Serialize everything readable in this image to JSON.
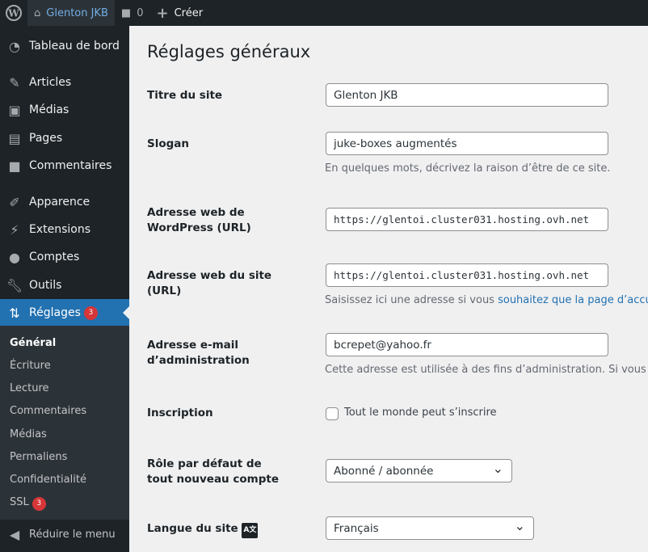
{
  "adminbar": {
    "site_name": "Glenton JKB",
    "comments_count": "0",
    "new_label": "Créer"
  },
  "sidebar": {
    "items": [
      {
        "label": "Tableau de bord",
        "icon": "dashboard-icon"
      },
      {
        "label": "Articles",
        "icon": "pin-icon"
      },
      {
        "label": "Médias",
        "icon": "media-icon"
      },
      {
        "label": "Pages",
        "icon": "pages-icon"
      },
      {
        "label": "Commentaires",
        "icon": "comments-icon"
      },
      {
        "label": "Apparence",
        "icon": "brush-icon"
      },
      {
        "label": "Extensions",
        "icon": "plugin-icon"
      },
      {
        "label": "Comptes",
        "icon": "user-icon"
      },
      {
        "label": "Outils",
        "icon": "wrench-icon"
      },
      {
        "label": "Réglages",
        "icon": "settings-icon",
        "badge": "3"
      }
    ],
    "submenu": [
      {
        "label": "Général"
      },
      {
        "label": "Écriture"
      },
      {
        "label": "Lecture"
      },
      {
        "label": "Commentaires"
      },
      {
        "label": "Médias"
      },
      {
        "label": "Permaliens"
      },
      {
        "label": "Confidentialité"
      },
      {
        "label": "SSL",
        "badge": "3"
      }
    ],
    "collapse_label": "Réduire le menu"
  },
  "page": {
    "title": "Réglages généraux",
    "site_title": {
      "label": "Titre du site",
      "value": "Glenton JKB"
    },
    "tagline": {
      "label": "Slogan",
      "value": "juke-boxes augmentés",
      "desc": "En quelques mots, décrivez la raison d’être de ce site."
    },
    "wp_url": {
      "label": "Adresse web de WordPress (URL)",
      "value": "https://glentoi.cluster031.hosting.ovh.net"
    },
    "site_url": {
      "label": "Adresse web du site (URL)",
      "value": "https://glentoi.cluster031.hosting.ovh.net",
      "desc": "Saisissez ici une adresse si vous ",
      "desc_link": "souhaitez que la page d’accueil d"
    },
    "email": {
      "label": "Adresse e-mail d’administration",
      "value": "bcrepet@yahoo.fr",
      "desc": "Cette adresse est utilisée à des fins d’administration. Si vous la ch"
    },
    "membership": {
      "label": "Inscription",
      "checkbox_label": "Tout le monde peut s’inscrire",
      "checked": false
    },
    "role": {
      "label": "Rôle par défaut de tout nouveau compte",
      "value": "Abonné / abonnée"
    },
    "language": {
      "label": "Langue du site",
      "value": "Français"
    }
  }
}
